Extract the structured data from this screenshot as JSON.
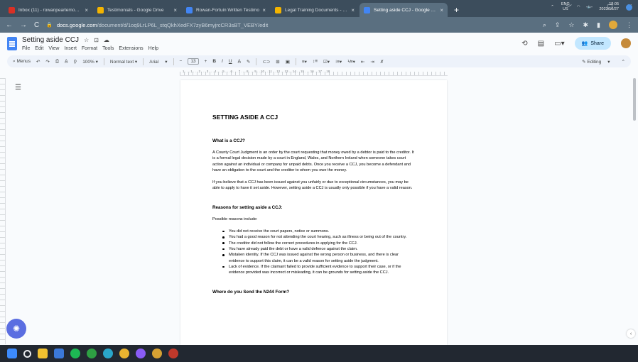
{
  "browser": {
    "tabs": [
      {
        "label": "Inbox (11) - rowanpearlemon@",
        "color": "#d93025",
        "active": false
      },
      {
        "label": "Testimonials - Google Drive",
        "color": "#f4b400",
        "active": false
      },
      {
        "label": "Rowan-Fortuin Written Testimo",
        "color": "#4285f4",
        "active": false
      },
      {
        "label": "Legal Training Documents - Goo",
        "color": "#f4b400",
        "active": false
      },
      {
        "label": "Setting aside CCJ - Google Docs",
        "color": "#4285f4",
        "active": true
      }
    ],
    "new_tab": "+",
    "window_controls": [
      "﹀",
      "—",
      "▢",
      "✕"
    ],
    "url_host": "docs.google.com",
    "url_path": "/document/d/1oq9LrLP6L_stqQkhXedFX7zyB6myjrcCR3sBT_VEBY/edit"
  },
  "docs": {
    "title": "Setting aside CCJ",
    "menus": [
      "File",
      "Edit",
      "View",
      "Insert",
      "Format",
      "Tools",
      "Extensions",
      "Help"
    ],
    "share_label": "Share",
    "toolbar": {
      "menus_label": "Menus",
      "zoom": "100%",
      "style": "Normal text",
      "font": "Arial",
      "font_size": "13",
      "editing_label": "Editing"
    },
    "ruler_numbers": "1 . . . 1 . . . 2 . . . 3 . . . 4 . . . 5 . . . 6 . . . 7 . . . 8 . . . 9 . . 10 . . 11 . . 12 . . 13 . . 14 . . 15 . . . 16 . . 17 . . 18"
  },
  "document": {
    "heading": "SETTING ASIDE A CCJ",
    "section1_title": "What is a CCJ?",
    "para1": "A County Court Judgment is an order by the court requesting that money owed by a debtor is paid to the creditor. It is a formal legal decision made by a court in England, Wales, and Northern Ireland when someone takes court action against an individual or company for unpaid debts. Once you receive a CCJ, you become a defendant and have an obligation to the court and the creditor to whom you owe the money.",
    "para2": "If you believe that a CCJ has been issued against you unfairly or due to exceptional circumstances, you may be able to apply to have it set aside. However, setting aside a CCJ is usually only possible if you have a valid reason.",
    "section2_title": "Reasons for setting aside a CCJ:",
    "possible_label": "Possible reasons include:",
    "reasons": [
      "You did not receive the court papers, notice or summons.",
      "You had a good reason for not attending the court hearing, such as illness or being out of the country.",
      "The creditor did not follow the correct procedures in applying for the CCJ.",
      "You have already paid the debt or have a valid defence against the claim.",
      "Mistaken identity. If the CCJ was issued against the wrong person or business, and there is clear evidence to support this claim, it can be a valid reason for setting aside the judgment.",
      "Lack of evidence. If the claimant failed to provide sufficient evidence to support their case, or if the evidence provided was incorrect or misleading, it can be grounds for setting aside the CCJ."
    ],
    "section3_title": "Where do you Send the N244 Form?"
  },
  "taskbar": {
    "apps": [
      {
        "icon": "windows-start-icon",
        "color": "#3d8bfd"
      },
      {
        "icon": "search-icon",
        "color": "#e8eaed"
      },
      {
        "icon": "file-explorer-icon",
        "color": "#f2c230"
      },
      {
        "icon": "widgets-icon",
        "color": "#3b78d8"
      },
      {
        "icon": "spotify-icon",
        "color": "#1db954"
      },
      {
        "icon": "xbox-icon",
        "color": "#2ea043"
      },
      {
        "icon": "edge-icon",
        "color": "#2aa6c9"
      },
      {
        "icon": "chrome-icon",
        "color": "#e8b330"
      },
      {
        "icon": "chrome-profile-icon",
        "color": "#8a5cf6"
      },
      {
        "icon": "chrome-beta-icon",
        "color": "#d6a133"
      },
      {
        "icon": "screen-recorder-icon",
        "color": "#c0392b"
      }
    ],
    "lang_line1": "ENG",
    "lang_line2": "US",
    "time": "18:05",
    "date": "2023/10/27"
  }
}
